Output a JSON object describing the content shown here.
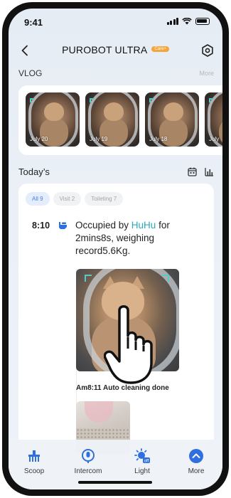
{
  "status_bar": {
    "time": "9:41"
  },
  "header": {
    "title": "PUROBOT ULTRA",
    "badge": "Care+"
  },
  "vlog": {
    "label": "VLOG",
    "more": "More",
    "items": [
      {
        "date": "July 20"
      },
      {
        "date": "July 19"
      },
      {
        "date": "July 18"
      },
      {
        "date": "July"
      }
    ]
  },
  "today": {
    "label": "Today’s",
    "filters": [
      {
        "label": "All 9",
        "active": true
      },
      {
        "label": "Visit 2",
        "active": false
      },
      {
        "label": "Toileting 7",
        "active": false
      }
    ],
    "event": {
      "time": "8:10",
      "text_before": "Occupied by ",
      "name": "HuHu",
      "text_after": " for 2mins8s, weighing record5.6Kg."
    },
    "event2": {
      "text": "Am8:11 Auto cleaning done"
    }
  },
  "nav": [
    {
      "label": "Scoop",
      "icon": "scoop-icon"
    },
    {
      "label": "Intercom",
      "icon": "microphone-icon"
    },
    {
      "label": "Light",
      "icon": "light-off-icon"
    },
    {
      "label": "More",
      "icon": "chevron-up-icon"
    }
  ],
  "colors": {
    "accent": "#2f6fe0",
    "name_highlight": "#2aa9b8",
    "badge": "#f5a53a"
  }
}
